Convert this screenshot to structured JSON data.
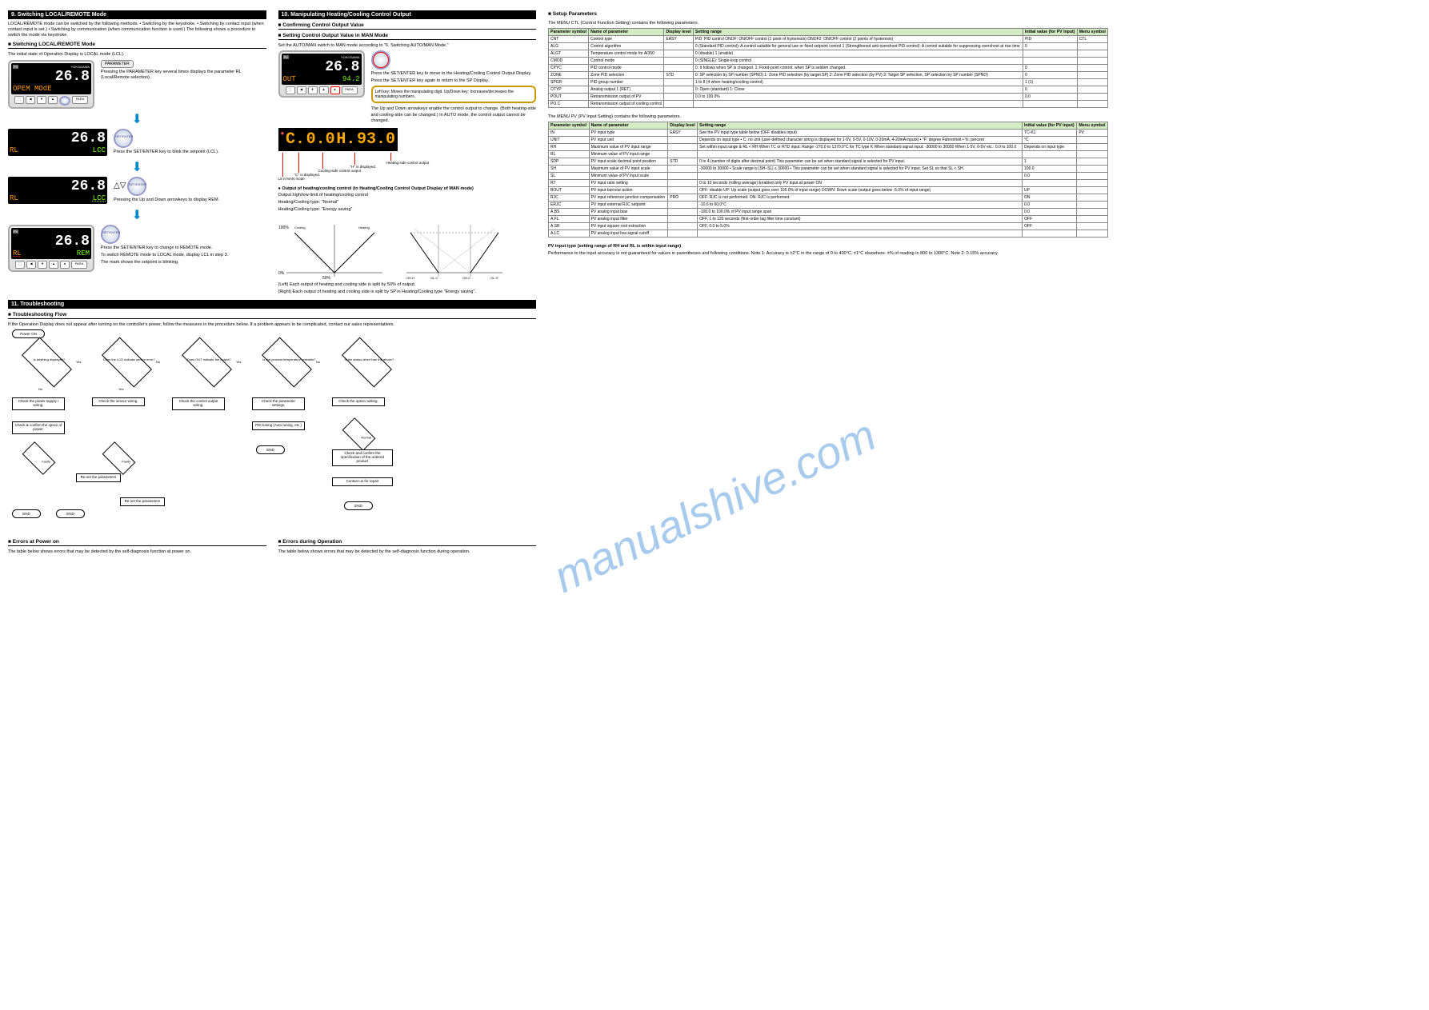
{
  "section9": {
    "header": "9. Switching LOCAL/REMOTE Mode",
    "intro": "LOCAL/REMOTE mode can be switched by the following methods.\n• Switching by the keystroke.\n• Switching by contact input (when contact input is set.)\n• Switching by communication (when communication function is used.)\nThe following shows a procedure to switch the mode via keystroke.",
    "sub": "■ Switching LOCAL/REMOTE Mode",
    "initial": "The initial state of Operation Display is LOCAL mode (LCL).",
    "step1": "Pressing the PARAMETER key several times displays the parameter RL (Local/Remote selection).",
    "step2": "Press the SET/ENTER key to blink the setpoint (LCL).",
    "step3": "Pressing the Up and Down arrowkeys to display REM.",
    "step4": "Press the SET/ENTER key to change to REMOTE mode.",
    "back": "To switch REMOTE mode to LOCAL mode, display LCL in step 3.",
    "param_lbl": "PARAMETER",
    "set_lbl": "SET/ENTER",
    "opem": "OPEM MOdE",
    "pv": "26.8",
    "rl": "RL",
    "lcl": "LCC",
    "rem": "REM",
    "note": "The mark     shows the setpoint is blinking."
  },
  "section10": {
    "header": "10. Manipulating Heating/Cooling Control Output",
    "sub_disp": "■ Confirming Control Output Value",
    "sub_set": "■ Setting Control Output Value in MAN Mode",
    "warn": "Set the AUTO/MAN switch to MAN mode according to \"6. Switching AUTO/MAN Mode.\"",
    "step1_a": "Press the SET/ENTER key to move to the Heating/Cooling Control Output Display.",
    "step1_b": "Press the SET/ENTER key again to return to the SP Display.",
    "step2": "The Up and Down arrowkeys enable the control output to change. (Both heating-side and cooling-side can be changed.) In AUTO mode, the control output cannot be changed.",
    "note_box": "Left key: Moves the manipulating digit.\nUp/Down key: Increases/decreases the manipulating numbers.",
    "disp_out": "OUT",
    "disp_val": "94.2",
    "bar_c": "C.",
    "bar_ch": "0.0",
    "bar_h": "H.",
    "bar_hv": "93.0",
    "bar_lbls": [
      "Lit in MAN mode",
      "\"C\" is displayed.",
      "Cooling-side control output",
      "\"H\" is displayed.",
      "Heating-side control output"
    ],
    "ohc_title": "● Output of heating/cooling control (in Heating/Cooling Control Output Display of MAN mode)",
    "ohc_table_head": "Output high/low-limit of heating/cooling control",
    "ohc_cases": [
      "Heating/Cooling type: \"Normal\"",
      "Heating/Cooling type: \"Energy saving\""
    ],
    "ohc_left": "(Left) Each output of heating and cooling side is split by 50% of output.",
    "ohc_right": "(Right) Each output of heating and cooling side is split by SP in Heating/Cooling type \"Energy saving\".",
    "ohc_graph_lbls": [
      "100%",
      "50%",
      "0%",
      "Cooling side",
      "Heating side",
      "OL.C",
      "OH.C",
      "OL.H",
      "OH.H"
    ]
  },
  "section11": {
    "header": "11. Troubleshooting",
    "sub": "■ Troubleshooting Flow",
    "intro": "If the Operation Display does not appear after turning on the controller's power, follow the measures in the procedure below.\nIf a problem appears to be complicated, contact our sales representatives.",
    "nodes": {
      "poweron": "Power ON",
      "q1": "Is anything\ndisplayed?",
      "q2": "Does the LCD\nindicate sensor\nerror?",
      "q3": "Does OUT\nindicate the\noutput?",
      "q4": "Is the process\ntemperature\nunstable?",
      "q5": "Is the status other\nthan the above?",
      "powercheck": "Check the power\nsupply / wiring.",
      "paramcheck": "Check the\nparameter\nsettings.",
      "outputcheck": "Check the\ncontrol output\nwiring.",
      "sensorcheck": "Check the\nsensor wiring.",
      "tune": "PID tuning\n(Auto tuning,\netc.)",
      "optcheck": "Check the option\nsetting.",
      "confirm": "Check & confirm\nthe specs of\npower.",
      "fault1": "Faulty",
      "fault2": "Faulty",
      "fault3": "Faulty",
      "normal1": "Normal",
      "normal2": "Normal",
      "end1": "END",
      "end2": "END",
      "end3": "END",
      "end4": "END",
      "end5": "END",
      "redo1": "Re-set the\nparameters",
      "redo2": "Re-set the\nparameters",
      "checkspec": "Check and confirm\nthe specification\nof the ordered\nproduct",
      "contact": "Contact us for\nrepair"
    },
    "sub_err": "■ Errors at Power on",
    "err_intro": "The table below shows errors that may be detected by the self-diagnosis function at power on.",
    "sub_opErr": "■ Errors during Operation",
    "opErr_intro": "The table below shows errors that may be detected by the self-diagnosis function during operation."
  },
  "section12": {
    "header": "■ Setup Parameters",
    "mctl_txt": "The MENU CTL (Control Function Setting) contains the following parameters.",
    "mpv_txt": "The MENU PV (PV Input Setting) contains the following parameters.",
    "ctl_table": {
      "head": [
        "Parameter symbol",
        "Name of parameter",
        "Display level",
        "Setting range",
        "Initial value (for PV input)",
        "Menu symbol"
      ],
      "rows": [
        [
          "CNT",
          "Control type",
          "EASY",
          "PID: PID control\nONOF: ON/OFF control (1 point of hysteresis)\nONOF2: ON/OFF control (2 points of hysteresis)",
          "PID",
          "CTL"
        ],
        [
          "ALG",
          "Control algorithm",
          "",
          "0 (Standard PID control):\n A control suitable for general use or fixed setpoint control\n1 (Strengthened anti-overshoot PID control):\n A control suitable for suppressing overshoot at rise time",
          "0",
          ""
        ],
        [
          "ALGT",
          "Temperature control mode for AI350",
          "",
          "0 (disable)\n1 (enable)",
          "",
          ""
        ],
        [
          "CMOD",
          "Control mode",
          "",
          "0 (SINGLE): Single-loop control",
          "",
          ""
        ],
        [
          "CPYC",
          "PID control mode",
          "",
          "0: It follows when SP is changed.\n1: Fixed-point control, when SP is seldom changed.",
          "0",
          ""
        ],
        [
          "ZONE",
          "Zone PID selection",
          "STD",
          "0: SP selection by SP number (SPNO)\n1: Zone PID selection (by target SP)\n2: Zone PID selection (by PV)\n3: Target SP selection, SP selection by SP number (SPNO)",
          "0",
          ""
        ],
        [
          "SPGR",
          "PID group number",
          "",
          "1 to 8 (4 when heating/cooling control)",
          "1 (1)",
          ""
        ],
        [
          "OTYP",
          "Analog output 1 (RET)",
          "",
          "0: Open (standard)\n1: Close",
          "0",
          ""
        ],
        [
          "POUT",
          "Retransmission output of PV",
          "",
          "0.0 to 100.0%",
          "0.0",
          ""
        ],
        [
          "PO.C",
          "Retransmission output of cooling control",
          "",
          "",
          "",
          ""
        ]
      ]
    },
    "pv_table": {
      "head": [
        "Parameter symbol",
        "Name of parameter",
        "Display level",
        "Setting range",
        "Initial value (for PV input)",
        "Menu symbol"
      ],
      "rows": [
        [
          "IN",
          "PV input type",
          "EASY",
          "See the PV input type table below (OFF disables input)",
          "TC-K1",
          "PV"
        ],
        [
          "UNIT",
          "PV input unit",
          "",
          "Depends on input type\n• C: no unit (user-defined character string is displayed for 1-5V, 0-5V, 0-10V, 0-20mA, 4-20mA inputs)\n• °F: degree Fahrenheit\n• %: percent",
          "°C",
          ""
        ],
        [
          "RH",
          "Maximum value of PV input range",
          "",
          "Set within input range & RL < RH\nWhen TC or RTD input:\n Range -270.0 to 1370.0°C for TC type K\n When standard signal input: -30000 to 30000\nWhen 1-5V, 0-5V etc.: 0.0 to 100.0",
          "Depends on input type",
          ""
        ],
        [
          "RL",
          "Minimum value of PV input range",
          "",
          "",
          "",
          ""
        ],
        [
          "SDP",
          "PV input scale decimal point position",
          "STD",
          "0 to 4 (number of digits after decimal point)\nThis parameter can be set when standard signal is selected for PV input.",
          "1",
          ""
        ],
        [
          "SH",
          "Maximum value of PV input scale",
          "",
          "-30000 to 30000\n• Scale range is |SH–SL| ≤ 30000\n• This parameter can be set when standard signal is selected for PV input.\nSet SL so that SL < SH.",
          "100.0",
          ""
        ],
        [
          "SL",
          "Minimum value of PV input scale",
          "",
          "",
          "0.0",
          ""
        ],
        [
          "RT",
          "PV input ratio setting",
          "",
          "0 to 10 seconds (rolling average)\nEnabled only PV input at power ON",
          "",
          ""
        ],
        [
          "BOUT",
          "PV input burnout action",
          "",
          "OFF: disable\nUP: Up scale (output goes over 105.0% of input range)\nDOWN: Down scale (output goes below -5.0% of input range)",
          "UP",
          ""
        ],
        [
          "RJC",
          "PV input reference junction compensation",
          "PRO",
          "OFF: RJC is not performed.\nON: RJC is performed.",
          "ON",
          ""
        ],
        [
          "ERJC",
          "PV input external RJC setpoint",
          "",
          "-10.0 to 60.0°C",
          "0.0",
          ""
        ],
        [
          "A.BS",
          "PV analog input bias",
          "",
          "-100.0 to 100.0% of PV input range span",
          "0.0",
          ""
        ],
        [
          "A.FL",
          "PV analog input filter",
          "",
          "OFF, 1 to 120 seconds (first-order lag filter time constant)",
          "OFF",
          ""
        ],
        [
          "A.SR",
          "PV input square root extraction",
          "",
          "OFF, 0.0 to 5.0%",
          "OFF",
          ""
        ],
        [
          "A.LC",
          "PV analog input low-signal cutoff",
          "",
          "",
          "",
          ""
        ]
      ]
    },
    "pv_type_table_title": "PV input type (setting range of RH and RL is within input range)",
    "note_bottom": "Performance to the input accuracy is not guaranteed for values in parentheses and following conditions.\nNote 1: Accuracy is ±2°C in the range of 0 to 400°C, ±1°C elsewhere. ±% of reading in 800 to 1300°C.\nNote 2: 0.15% accuracy."
  }
}
